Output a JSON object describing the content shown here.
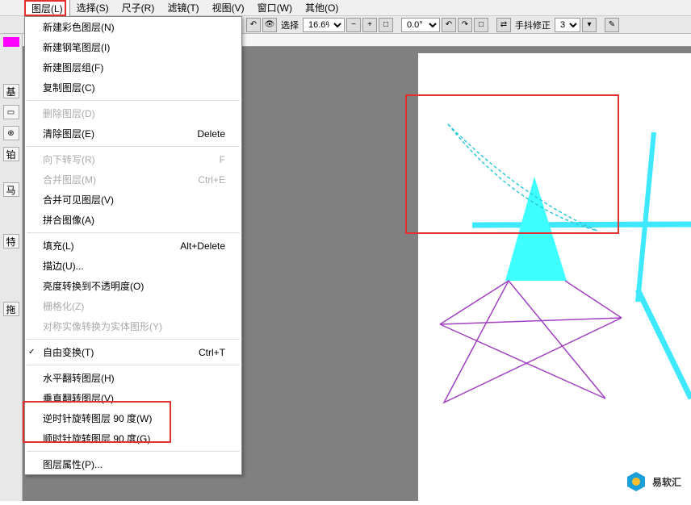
{
  "menubar": {
    "items": [
      {
        "label": "图层(L)"
      },
      {
        "label": "选择(S)"
      },
      {
        "label": "尺子(R)"
      },
      {
        "label": "滤镜(T)"
      },
      {
        "label": "视图(V)"
      },
      {
        "label": "窗口(W)"
      },
      {
        "label": "其他(O)"
      }
    ]
  },
  "toolbar": {
    "eye_icon": "eye",
    "select_label": "选择",
    "zoom": "16.6%",
    "angle": "0.0°",
    "stabilizer_label": "手抖修正",
    "stabilizer_value": "3"
  },
  "left_panel": {
    "swatch1": "#ff00ff",
    "label_ji": "基",
    "label_bo": "铂",
    "label_ma": "马",
    "label_te": "特",
    "label_tuo": "拖"
  },
  "dropdown": {
    "items": [
      {
        "label": "新建彩色图层(N)",
        "disabled": false
      },
      {
        "label": "新建钢笔图层(I)",
        "disabled": false
      },
      {
        "label": "新建图层组(F)",
        "disabled": false
      },
      {
        "label": "复制图层(C)",
        "disabled": false
      },
      {
        "sep": true
      },
      {
        "label": "删除图层(D)",
        "disabled": true
      },
      {
        "label": "清除图层(E)",
        "shortcut": "Delete",
        "disabled": false
      },
      {
        "sep": true
      },
      {
        "label": "向下转写(R)",
        "shortcut": "F",
        "disabled": true
      },
      {
        "label": "合并图层(M)",
        "shortcut": "Ctrl+E",
        "disabled": true
      },
      {
        "label": "合并可见图层(V)",
        "disabled": false
      },
      {
        "label": "拼合图像(A)",
        "disabled": false
      },
      {
        "sep": true
      },
      {
        "label": "填充(L)",
        "shortcut": "Alt+Delete",
        "disabled": false
      },
      {
        "label": "描边(U)...",
        "disabled": false
      },
      {
        "label": "亮度转换到不透明度(O)",
        "disabled": false
      },
      {
        "label": "栅格化(Z)",
        "disabled": true
      },
      {
        "label": "对称实像转换为实体图形(Y)",
        "disabled": true
      },
      {
        "sep": true
      },
      {
        "label": "自由变换(T)",
        "shortcut": "Ctrl+T",
        "checked": true,
        "disabled": false
      },
      {
        "sep": true
      },
      {
        "label": "水平翻转图层(H)",
        "disabled": false
      },
      {
        "label": "垂直翻转图层(V)",
        "disabled": false
      },
      {
        "label": "逆时针旋转图层 90 度(W)",
        "disabled": false
      },
      {
        "label": "顺时针旋转图层 90 度(G)",
        "disabled": false
      },
      {
        "sep": true
      },
      {
        "label": "图层属性(P)...",
        "disabled": false
      }
    ]
  },
  "watermark": {
    "text": "易软汇"
  }
}
